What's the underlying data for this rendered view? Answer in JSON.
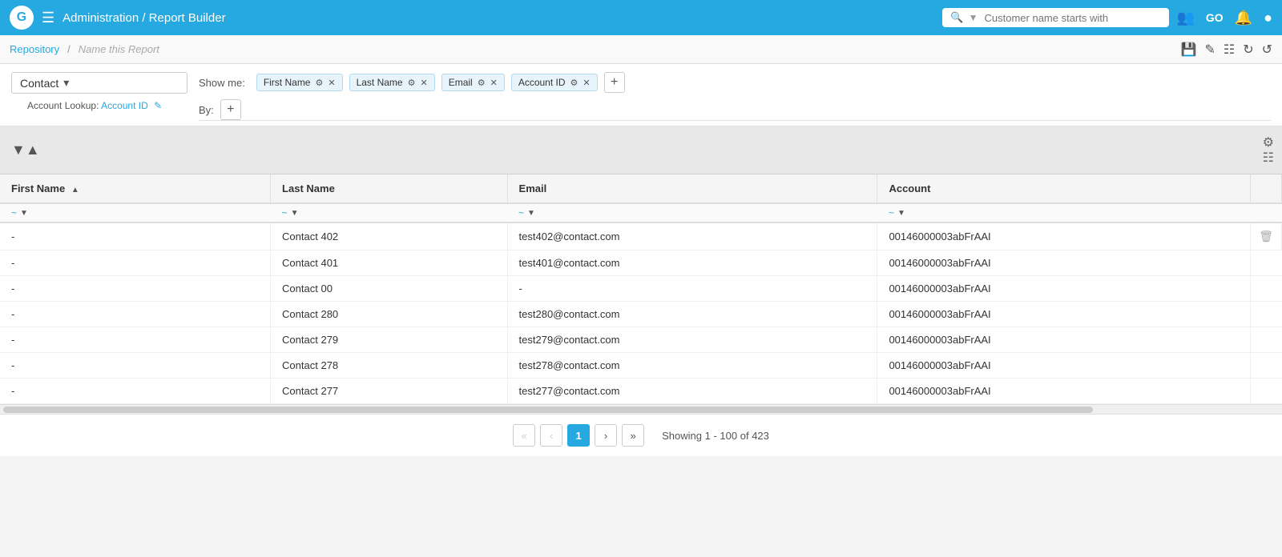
{
  "topNav": {
    "logoText": "G",
    "breadcrumbTitle": "Administration / Report Builder",
    "searchPlaceholder": "Customer name starts with",
    "navIcons": [
      "users-icon",
      "go-icon",
      "bell-icon",
      "user-icon"
    ]
  },
  "subheader": {
    "repositoryLabel": "Repository",
    "separator": "/",
    "reportName": "Name this Report",
    "rightIcons": [
      "save-icon",
      "edit-icon",
      "chart-icon",
      "refresh-icon",
      "reload-icon"
    ]
  },
  "showMe": {
    "label": "Show me:",
    "fields": [
      {
        "name": "First Name",
        "id": "first-name"
      },
      {
        "name": "Last Name",
        "id": "last-name"
      },
      {
        "name": "Email",
        "id": "email"
      },
      {
        "name": "Account ID",
        "id": "account-id"
      }
    ],
    "addButtonLabel": "+"
  },
  "byBar": {
    "label": "By:",
    "addButtonLabel": "+"
  },
  "contactSection": {
    "selectorLabel": "Contact",
    "accountLookupLabel": "Account Lookup:",
    "accountLookupValue": "Account ID",
    "editIconLabel": "✎"
  },
  "columns": [
    {
      "id": "first-name",
      "label": "First Name",
      "sortIcon": "▲"
    },
    {
      "id": "last-name",
      "label": "Last Name",
      "sortIcon": ""
    },
    {
      "id": "email",
      "label": "Email",
      "sortIcon": ""
    },
    {
      "id": "account-id",
      "label": "Account",
      "sortIcon": ""
    }
  ],
  "tableRows": [
    {
      "firstName": "-",
      "lastName": "Contact 402",
      "email": "test402@contact.com",
      "accountId": "00146000003abFrAAI"
    },
    {
      "firstName": "-",
      "lastName": "Contact 401",
      "email": "test401@contact.com",
      "accountId": "00146000003abFrAAI"
    },
    {
      "firstName": "-",
      "lastName": "Contact 00",
      "email": "-",
      "accountId": "00146000003abFrAAI"
    },
    {
      "firstName": "-",
      "lastName": "Contact 280",
      "email": "test280@contact.com",
      "accountId": "00146000003abFrAAI"
    },
    {
      "firstName": "-",
      "lastName": "Contact 279",
      "email": "test279@contact.com",
      "accountId": "00146000003abFrAAI"
    },
    {
      "firstName": "-",
      "lastName": "Contact 278",
      "email": "test278@contact.com",
      "accountId": "00146000003abFrAAI"
    },
    {
      "firstName": "-",
      "lastName": "Contact 277",
      "email": "test277@contact.com",
      "accountId": "00146000003abFrAAI"
    }
  ],
  "pagination": {
    "prevPrevLabel": "«",
    "prevLabel": "‹",
    "currentPage": "1",
    "nextLabel": "›",
    "nextNextLabel": "»",
    "showingText": "Showing",
    "rangeStart": "1",
    "rangeEnd": "100",
    "totalLabel": "of",
    "total": "423"
  }
}
